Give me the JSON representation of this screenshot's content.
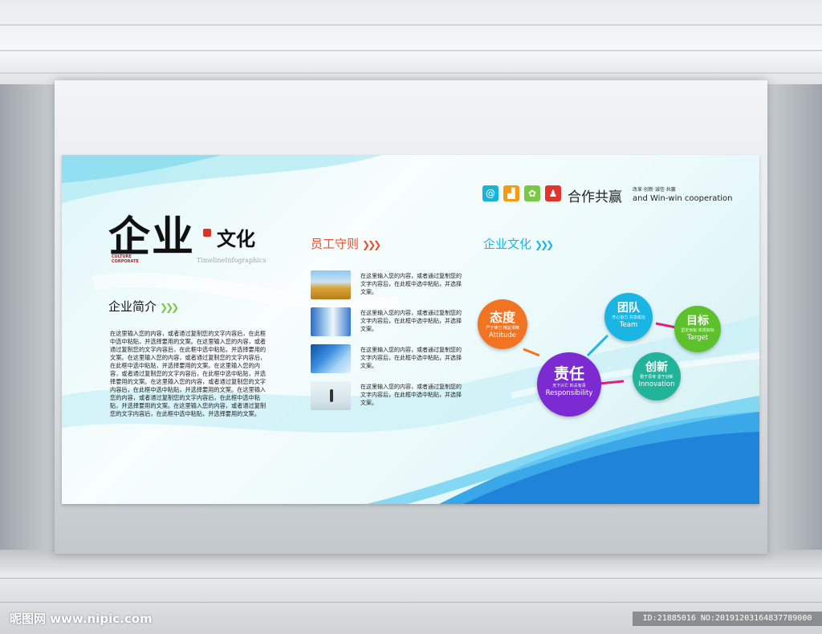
{
  "board": {
    "title_big": "企业",
    "title_small": "文化",
    "title_tiny": "CULTURE\nCORPORATE",
    "title_sub": "TimelineInfographics",
    "intro": {
      "title": "企业简介",
      "body": "在这里输入您的内容，或者通过复制您的文字内容后，在此框中选中粘贴，并选择要用的文案。在这里输入您的内容，或者通过复制您的文字内容后，在此框中选中粘贴，并选择要用的文案。在这里输入您的内容，或者通过复制您的文字内容后，在此框中选中粘贴，并选择要用的文案。在这里输入您的内容，或者通过复制您的文字内容后，在此框中选中粘贴，并选择要用的文案。在这里输入您的内容，或者通过复制您的文字内容后，在此框中选中粘贴，并选择要用的文案。在这里输入您的内容，或者通过复制您的文字内容后，在此框中选中粘贴，并选择要用的文案。在这里输入您的内容，或者通过复制您的文字内容后，在此框中选中粘贴，并选择要用的文案。"
    },
    "rules": {
      "title": "员工守则",
      "items": [
        {
          "text": "在这里输入您的内容，或者通过复制您的文字内容后，在此框中选中粘贴，并选择文案。",
          "image": "wheat-field"
        },
        {
          "text": "在这里输入您的内容，或者通过复制您的文字内容后，在此框中选中粘贴，并选择文案。",
          "image": "handshake"
        },
        {
          "text": "在这里输入您的内容，或者通过复制您的文字内容后，在此框中选中粘贴，并选择文案。",
          "image": "buildings"
        },
        {
          "text": "在这里输入您的内容，或者通过复制您的文字内容后，在此框中选中粘贴，并选择文案。",
          "image": "businessman"
        }
      ]
    },
    "culture": {
      "title": "企业文化",
      "circles": [
        {
          "cn": "态度",
          "tiny": "严于律己  精益求精",
          "en": "Attitude",
          "color": "#f07422"
        },
        {
          "cn": "团队",
          "tiny": "齐心协力  共享成功",
          "en": "Team",
          "color": "#1ab5e3"
        },
        {
          "cn": "目标",
          "tiny": "坚定目标  实现目标",
          "en": "Target",
          "color": "#5cc12b"
        },
        {
          "cn": "创新",
          "tiny": "勤于思考  善于创新",
          "en": "Innovation",
          "color": "#22b39b"
        },
        {
          "cn": "责任",
          "tiny": "天下兴亡  匹夫有责",
          "en": "Responsibility",
          "color": "#7b2bd1"
        }
      ]
    },
    "cooperation": {
      "cn": "合作共赢",
      "small": "改革·创新·诚信·共赢",
      "en": "and Win-win  cooperation",
      "icons": [
        "at-icon",
        "chart-icon",
        "flower-icon",
        "person-icon"
      ],
      "icon_colors": [
        "#19b3d8",
        "#f39c12",
        "#7ac943",
        "#e2342d"
      ]
    }
  },
  "watermark": {
    "left": "昵图网 www.nipic.com",
    "right": "ID:21885016 NO:20191203164837789000"
  }
}
